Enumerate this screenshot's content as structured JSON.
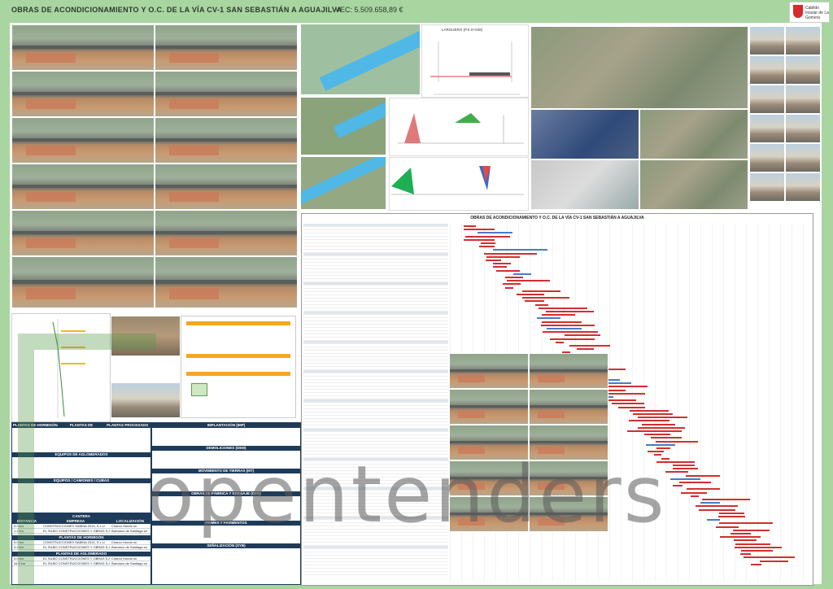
{
  "header": {
    "title": "OBRAS DE ACONDICIONAMIENTO Y O.C. DE LA VÍA CV-1 SAN SEBASTIÁN A AGUAJILVA",
    "budget": "VEC: 5.509.658,89 €"
  },
  "logo": {
    "text": "Cabildo Insular de La Gomera"
  },
  "profile": {
    "title": "LARGUERO (P.K.0+038)"
  },
  "gantt": {
    "title": "OBRAS DE ACONDICIONAMIENTO Y O.C. DE LA VÍA CV-1 SAN SEBASTIÁN A AGUAJILVA"
  },
  "tables": {
    "plantas_hormigon": "PLANTAS DE HORMIGÓN",
    "plantas_aglomerado": "PLANTAS DE AGLOMERADO",
    "plantas_aridos": "PLANTAS PROCESADO ÁRIDOS",
    "equipos_aglomerados": "EQUIPOS DE AGLOMERADOS",
    "equipos_camiones": "EQUIPOS / CAMIONES / CUBAS",
    "implantacion": "IMPLANTACIÓN (IMP)",
    "demoliciones": "DEMOLICIONES (DEM)",
    "movimiento_tierras": "MOVIMIENTO DE TIERRAS (MT)",
    "obras_fabrica": "OBRAS DE FÁBRICA Y DRENAJE (OFD)",
    "firmes": "FIRMES Y PAVIMENTOS",
    "senalizacion": "SEÑALIZACIÓN (SYB)",
    "rendimiento": "RENDIMIENTO",
    "cantera": "CANTERA",
    "distancia": "DISTANCIA",
    "empresa": "EMPRESA",
    "localizacion": "LOCALIZACIÓN",
    "rows": [
      {
        "dist": "5.0 km",
        "empresa": "CONSTRUCCIONES SABINA 2014, S.L.U",
        "loc": "Charco Hondo sn"
      },
      {
        "dist": "1.2 km",
        "empresa": "EL SILBO CONSTRUCCIONES Y OBRAS S.A.",
        "loc": "Barranco de Santiago sn"
      }
    ],
    "rows_hormigon": [
      {
        "dist": "5.0 km",
        "empresa": "CONSTRUCCIONES SABINA 2014, S.L.U",
        "loc": "Charco Hondo sn"
      },
      {
        "dist": "3.2 km",
        "empresa": "EL SILBO CONSTRUCCIONES Y OBRAS S.A.",
        "loc": "Barranco de Santiago sn"
      }
    ],
    "rows_aglomerado": [
      {
        "dist": "5.0 km",
        "empresa": "EL SILBO CONSTRUCCIONES Y OBRAS S.A.",
        "loc": "Charco Hondo sn"
      },
      {
        "dist": "34.5 km",
        "empresa": "EL SILBO CONSTRUCCIONES Y OBRAS S.A.",
        "loc": "Barranco de Santiago sn"
      }
    ]
  },
  "watermark": "opentenders"
}
